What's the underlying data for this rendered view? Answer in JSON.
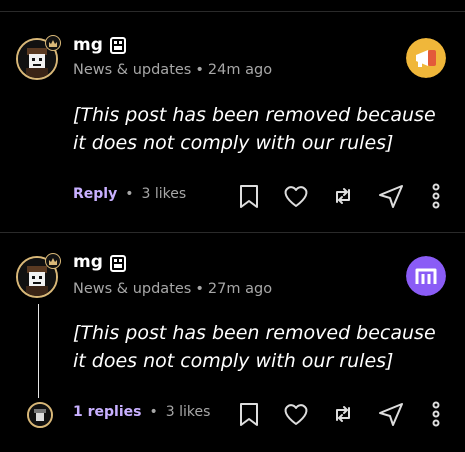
{
  "posts": [
    {
      "username": "mg",
      "category": "News & updates",
      "separator": "•",
      "time": "24m ago",
      "body": "[This post has been removed because it does not comply with our rules]",
      "action_link": "Reply",
      "likes": "3 likes",
      "community_icon": "megaphone-icon",
      "community_color": "#f0b73a"
    },
    {
      "username": "mg",
      "category": "News & updates",
      "separator": "•",
      "time": "27m ago",
      "body": "[This post has been removed because it does not comply with our rules]",
      "action_link": "1 replies",
      "likes": "3 likes",
      "community_icon": "m-logo-icon",
      "community_color": "#8a5cf6"
    }
  ],
  "colors": {
    "accent": "#c8b0ff",
    "avatar_ring": "#d9b878",
    "muted_text": "#a7a7a7",
    "background": "#000000"
  },
  "icons": [
    "bookmark-icon",
    "heart-icon",
    "repost-icon",
    "share-icon",
    "more-icon"
  ]
}
